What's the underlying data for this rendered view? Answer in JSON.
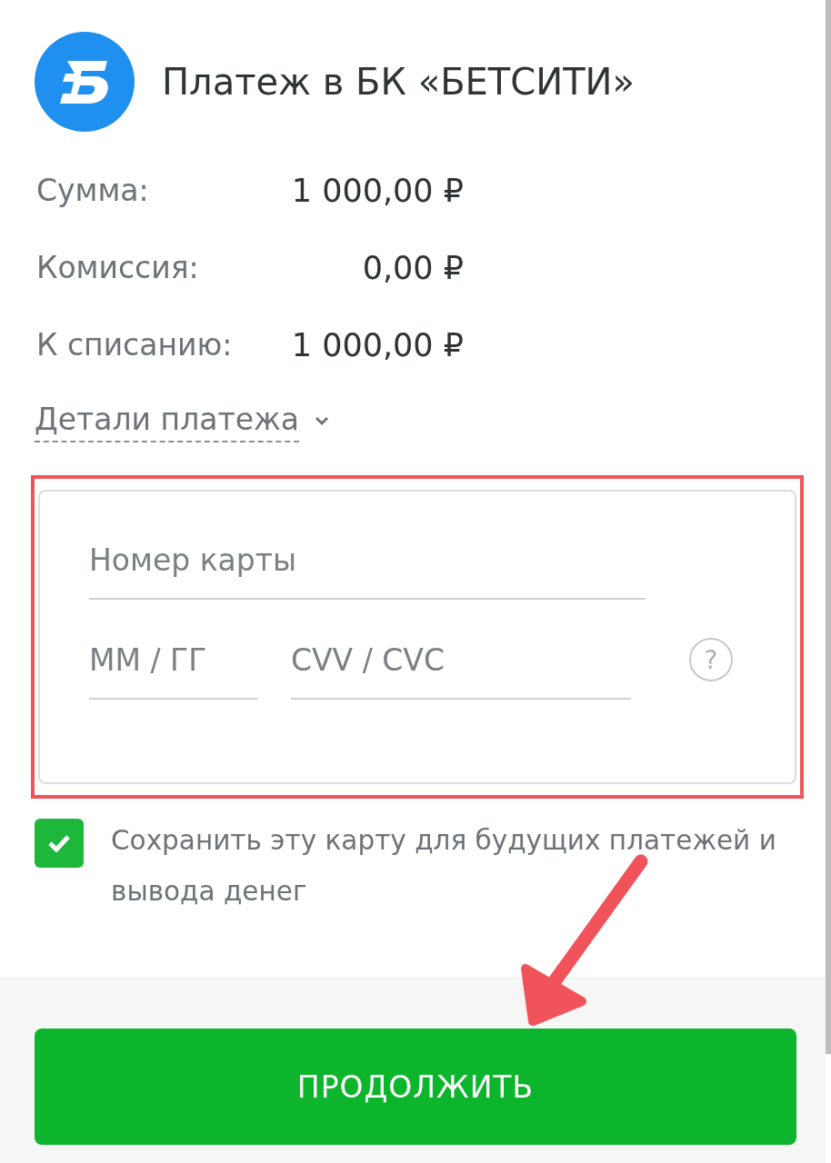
{
  "header": {
    "title": "Платеж в БК «БЕТСИТИ»"
  },
  "summary": [
    {
      "label": "Сумма:",
      "value": "1 000,00 ₽"
    },
    {
      "label": "Комиссия:",
      "value": "0,00 ₽"
    },
    {
      "label": "К списанию:",
      "value": "1 000,00 ₽"
    }
  ],
  "details_link": {
    "label": "Детали платежа",
    "expanded": false
  },
  "card_form": {
    "highlighted": true,
    "fields": [
      {
        "kind": "card-number",
        "placeholder": "Номер карты"
      },
      {
        "kind": "expiry",
        "placeholder": "ММ / ГГ"
      },
      {
        "kind": "cvv",
        "placeholder": "CVV / CVC"
      }
    ],
    "help": "?"
  },
  "save_card": {
    "checked": true,
    "label": "Сохранить эту карту для будущих платежей и вывода денег"
  },
  "submit": {
    "label": "ПРОДОЛЖИТЬ"
  },
  "annotation": {
    "kind": "arrow"
  }
}
